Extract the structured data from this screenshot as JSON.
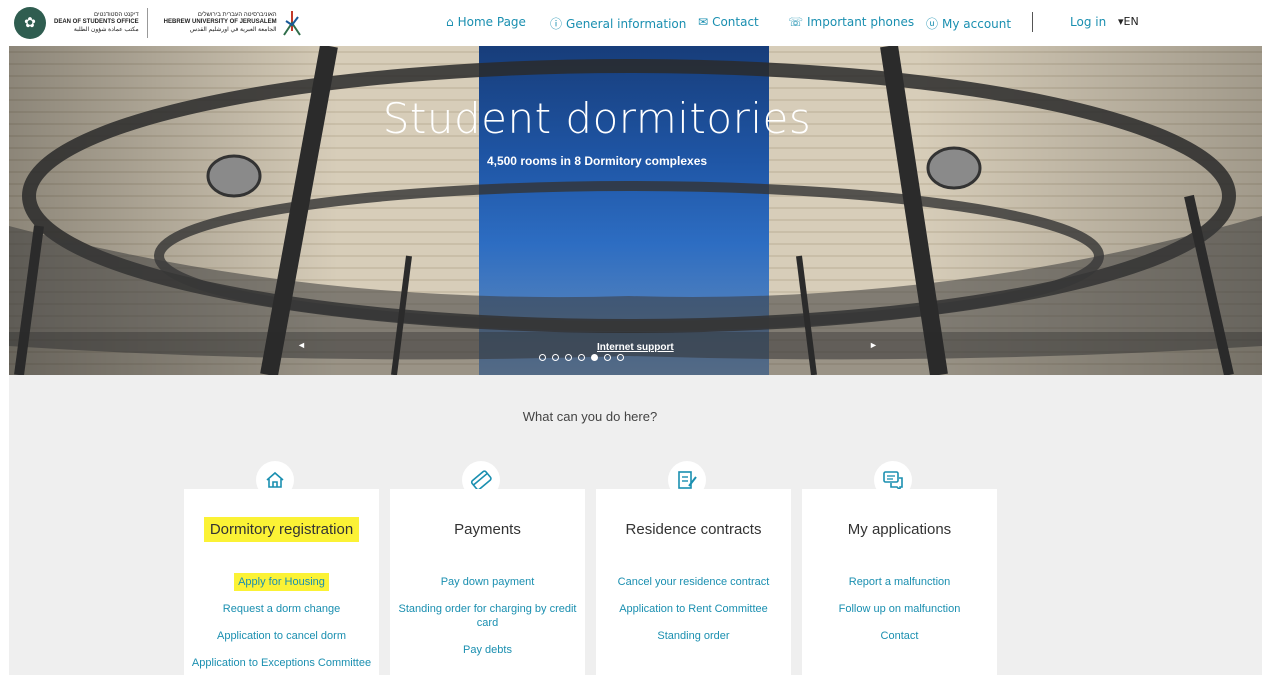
{
  "header": {
    "logo": {
      "dso_hebrew": "דיקנט הסטודנטים",
      "dso_english": "DEAN OF STUDENTS OFFICE",
      "dso_arabic": "مكتب عمادة شؤون الطلبة",
      "huji_hebrew": "האוניברסיטה העברית בירושלים",
      "huji_english": "HEBREW UNIVERSITY OF JERUSALEM",
      "huji_arabic": "الجامعة العبرية في اورشليم القدس"
    },
    "nav": [
      {
        "label": "Home Page",
        "icon": "home-icon"
      },
      {
        "label": "General information",
        "icon": "info-icon"
      },
      {
        "label": "Contact",
        "icon": "contact-icon"
      },
      {
        "label": "Important phones",
        "icon": "phone-icon"
      },
      {
        "label": "My account",
        "icon": "account-icon"
      }
    ],
    "login": "Log in",
    "language": "▾EN"
  },
  "hero": {
    "title": "Student dormitories",
    "subtitle": "4,500 rooms in 8 Dormitory complexes",
    "caption_link": "Internet support",
    "slide_count": 7,
    "active_slide": 5
  },
  "main": {
    "heading": "What can you do here?",
    "cards": [
      {
        "title": "Dormitory registration",
        "icon": "home-icon",
        "highlighted": true,
        "links": [
          "Apply for Housing",
          "Request a dorm change",
          "Application to cancel dorm",
          "Application to Exceptions Committee"
        ]
      },
      {
        "title": "Payments",
        "icon": "credit-card-icon",
        "highlighted": false,
        "links": [
          "Pay down payment",
          "Standing order for charging by credit card",
          "Pay debts"
        ]
      },
      {
        "title": "Residence contracts",
        "icon": "contract-edit-icon",
        "highlighted": false,
        "links": [
          "Cancel your residence contract",
          "Application to Rent Committee",
          "Standing order"
        ]
      },
      {
        "title": "My applications",
        "icon": "chat-icon",
        "highlighted": false,
        "links": [
          "Report a malfunction",
          "Follow up on malfunction",
          "Contact"
        ]
      }
    ]
  },
  "colors": {
    "link": "#1a8fb0",
    "highlight": "#fbf235",
    "background": "#efefef"
  }
}
